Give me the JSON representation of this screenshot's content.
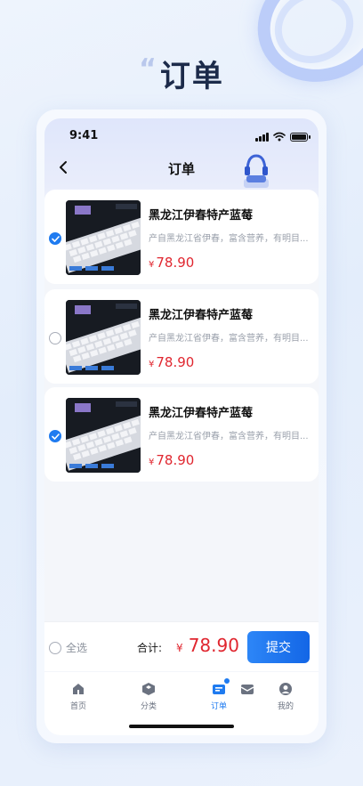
{
  "page": {
    "heading": "订单"
  },
  "status_bar": {
    "time": "9:41"
  },
  "nav": {
    "title": "订单"
  },
  "cart_items": [
    {
      "title": "黑龙江伊春特产蓝莓",
      "description": "产自黑龙江省伊春，富含营养，有明目...",
      "currency": "¥",
      "price": "78.90",
      "selected": true
    },
    {
      "title": "黑龙江伊春特产蓝莓",
      "description": "产自黑龙江省伊春，富含营养，有明目...",
      "currency": "¥",
      "price": "78.90",
      "selected": false
    },
    {
      "title": "黑龙江伊春特产蓝莓",
      "description": "产自黑龙江省伊春，富含营养，有明目...",
      "currency": "¥",
      "price": "78.90",
      "selected": true
    }
  ],
  "summary": {
    "select_all_label": "全选",
    "total_label": "合计:",
    "currency": "¥",
    "total": "78.90",
    "submit_label": "提交"
  },
  "tabs": [
    {
      "label": "首页",
      "icon": "home-icon",
      "active": false
    },
    {
      "label": "分类",
      "icon": "category-icon",
      "active": false
    },
    {
      "label": "订单",
      "icon": "orders-icon",
      "active": true
    },
    {
      "label": "",
      "icon": "inbox-icon",
      "active": false
    },
    {
      "label": "我的",
      "icon": "profile-icon",
      "active": false
    }
  ],
  "colors": {
    "accent": "#1f7bf0",
    "price": "#e0262f",
    "heading": "#1c2b4a"
  }
}
